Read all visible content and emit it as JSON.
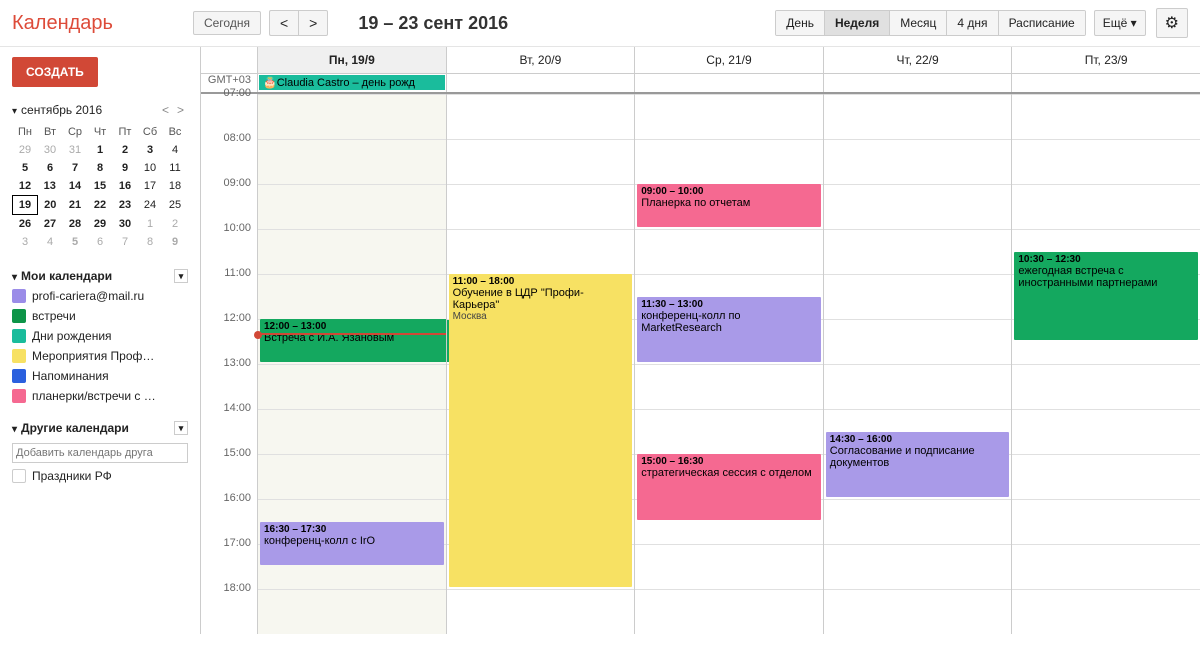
{
  "header": {
    "logo": "Календарь",
    "today": "Сегодня",
    "prev": "<",
    "next": ">",
    "dateRange": "19 – 23 сент 2016",
    "views": [
      "День",
      "Неделя",
      "Месяц",
      "4 дня",
      "Расписание"
    ],
    "activeView": 1,
    "more": "Ещё ▾",
    "gear": "⚙"
  },
  "sidebar": {
    "create": "СОЗДАТЬ",
    "miniCal": {
      "title": "сентябрь 2016",
      "dow": [
        "Пн",
        "Вт",
        "Ср",
        "Чт",
        "Пт",
        "Сб",
        "Вс"
      ],
      "weeks": [
        [
          {
            "n": 29,
            "g": 1
          },
          {
            "n": 30,
            "g": 1
          },
          {
            "n": 31,
            "g": 1
          },
          {
            "n": 1,
            "b": 1
          },
          {
            "n": 2,
            "b": 1
          },
          {
            "n": 3,
            "b": 1
          },
          {
            "n": 4
          }
        ],
        [
          {
            "n": 5,
            "b": 1
          },
          {
            "n": 6,
            "b": 1
          },
          {
            "n": 7,
            "b": 1
          },
          {
            "n": 8,
            "b": 1
          },
          {
            "n": 9,
            "b": 1
          },
          {
            "n": 10
          },
          {
            "n": 11
          }
        ],
        [
          {
            "n": 12,
            "b": 1
          },
          {
            "n": 13,
            "b": 1
          },
          {
            "n": 14,
            "b": 1
          },
          {
            "n": 15,
            "b": 1
          },
          {
            "n": 16,
            "b": 1
          },
          {
            "n": 17
          },
          {
            "n": 18
          }
        ],
        [
          {
            "n": 19,
            "b": 1,
            "t": 1
          },
          {
            "n": 20,
            "b": 1
          },
          {
            "n": 21,
            "b": 1
          },
          {
            "n": 22,
            "b": 1
          },
          {
            "n": 23,
            "b": 1
          },
          {
            "n": 24
          },
          {
            "n": 25
          }
        ],
        [
          {
            "n": 26,
            "b": 1
          },
          {
            "n": 27,
            "b": 1
          },
          {
            "n": 28,
            "b": 1
          },
          {
            "n": 29,
            "b": 1
          },
          {
            "n": 30,
            "b": 1
          },
          {
            "n": 1,
            "g": 1
          },
          {
            "n": 2,
            "g": 1
          }
        ],
        [
          {
            "n": 3,
            "g": 1
          },
          {
            "n": 4,
            "g": 1
          },
          {
            "n": 5,
            "g": 1,
            "b": 1
          },
          {
            "n": 6,
            "g": 1
          },
          {
            "n": 7,
            "g": 1
          },
          {
            "n": 8,
            "g": 1
          },
          {
            "n": 9,
            "g": 1,
            "b": 1
          }
        ]
      ]
    },
    "myCals": {
      "title": "Мои календари",
      "items": [
        {
          "label": "profi-cariera@mail.ru",
          "color": "#9b8ce8"
        },
        {
          "label": "встречи",
          "color": "#0d9448"
        },
        {
          "label": "Дни рождения",
          "color": "#1abc9c"
        },
        {
          "label": "Мероприятия Проф…",
          "color": "#f7e163"
        },
        {
          "label": "Напоминания",
          "color": "#2b60de"
        },
        {
          "label": "планерки/встречи с …",
          "color": "#f56991"
        }
      ]
    },
    "otherCals": {
      "title": "Другие календари",
      "placeholder": "Добавить календарь друга",
      "items": [
        {
          "label": "Праздники РФ",
          "color": "#fff",
          "border": "#ccc"
        }
      ]
    }
  },
  "grid": {
    "tz": "GMT+03",
    "days": [
      "Пн, 19/9",
      "Вт, 20/9",
      "Ср, 21/9",
      "Чт, 22/9",
      "Пт, 23/9"
    ],
    "todayIndex": 0,
    "hours": [
      "07:00",
      "08:00",
      "09:00",
      "10:00",
      "11:00",
      "12:00",
      "13:00",
      "14:00",
      "15:00",
      "16:00",
      "17:00",
      "18:00"
    ],
    "startHour": 7,
    "hourHeight": 45,
    "nowHour": 12.3,
    "allday": [
      {
        "day": 0,
        "title": "Claudia Castro – день рожд",
        "icon": "🎂",
        "color": "#1abc9c"
      }
    ],
    "events": [
      {
        "day": 0,
        "start": 12.0,
        "end": 13.0,
        "time": "12:00 – 13:00",
        "title": "Встреча с И.А. Язановым",
        "color": "#14a85f",
        "leftHalf": true
      },
      {
        "day": 0,
        "start": 16.5,
        "end": 17.5,
        "time": "16:30 – 17:30",
        "title": "конференц-колл с IrO",
        "color": "#a99ae8"
      },
      {
        "day": 1,
        "start": 11.0,
        "end": 18.0,
        "time": "11:00 – 18:00",
        "title": "Обучение в ЦДР \"Профи-Карьера\"",
        "loc": "Москва",
        "color": "#f7e163"
      },
      {
        "day": 2,
        "start": 9.0,
        "end": 10.0,
        "time": "09:00 – 10:00",
        "title": "Планерка по отчетам",
        "color": "#f56991"
      },
      {
        "day": 2,
        "start": 11.5,
        "end": 13.0,
        "time": "11:30 – 13:00",
        "title": "конференц-колл по MarketResearch",
        "color": "#a99ae8"
      },
      {
        "day": 2,
        "start": 15.0,
        "end": 16.5,
        "time": "15:00 – 16:30",
        "title": "стратегическая сессия с отделом",
        "color": "#f56991"
      },
      {
        "day": 3,
        "start": 14.5,
        "end": 16.0,
        "time": "14:30 – 16:00",
        "title": "Согласование и подписание документов",
        "color": "#a99ae8"
      },
      {
        "day": 4,
        "start": 10.5,
        "end": 12.5,
        "time": "10:30 – 12:30",
        "title": "ежегодная встреча с иностранными партнерами",
        "color": "#14a85f"
      }
    ]
  }
}
